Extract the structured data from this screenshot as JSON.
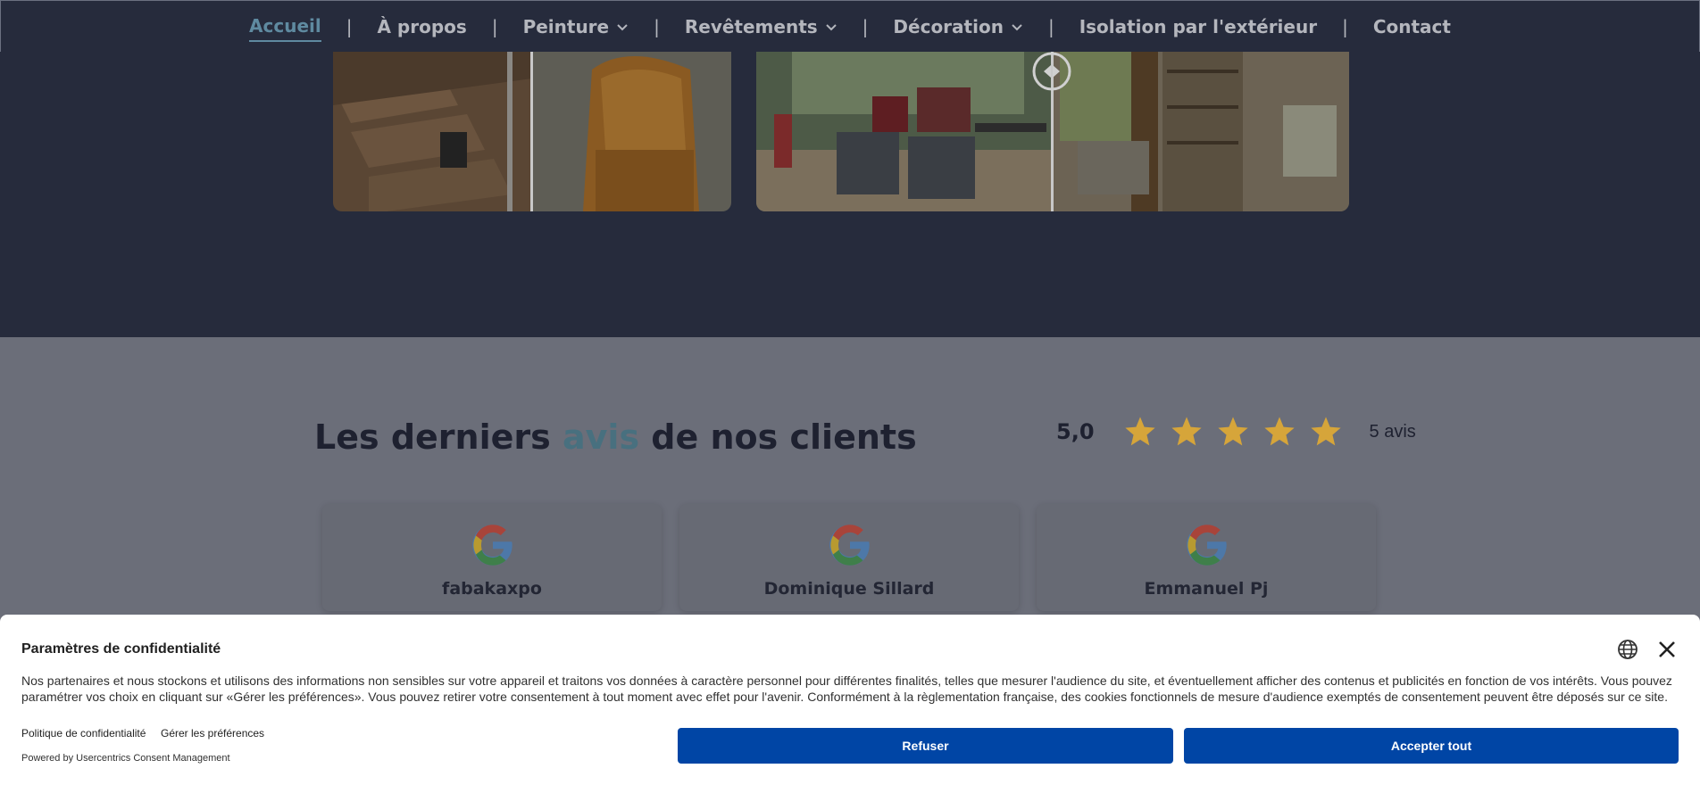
{
  "nav": {
    "items": [
      {
        "label": "Accueil",
        "active": true
      },
      {
        "label": "À propos"
      },
      {
        "label": "Peinture",
        "dropdown": true
      },
      {
        "label": "Revêtements",
        "dropdown": true
      },
      {
        "label": "Décoration",
        "dropdown": true
      },
      {
        "label": "Isolation par l'extérieur"
      },
      {
        "label": "Contact"
      }
    ],
    "separator": "|"
  },
  "reviews": {
    "title_part1": "Les derniers ",
    "title_accent": "avis",
    "title_part2": " de nos clients",
    "rating_value": "5,0",
    "stars": 5,
    "count_label": "5 avis",
    "cards": [
      {
        "name": "fabakaxpo"
      },
      {
        "name": "Dominique Sillard"
      },
      {
        "name": "Emmanuel Pj"
      }
    ]
  },
  "consent": {
    "title": "Paramètres de confidentialité",
    "text": "Nos partenaires et nous stockons et utilisons des informations non sensibles sur votre appareil et traitons vos données à caractère personnel pour différentes finalités, telles que mesurer l'audience du site, et éventuellement afficher des contenus et publicités en fonction de vos intérêts. Vous pouvez paramétrer vos choix en cliquant sur «Gérer les préférences». Vous pouvez retirer votre consentement à tout moment avec effet pour l'avenir. Conformément à la règlementation française, des cookies fonctionnels de mesure d'audience exemptés de consentement peuvent être déposés sur ce site.",
    "privacy_link": "Politique de confidentialité",
    "manage_link": "Gérer les préférences",
    "powered": "Powered by Usercentrics Consent Management",
    "refuse_label": "Refuser",
    "accept_label": "Accepter tout"
  },
  "colors": {
    "nav_bg": "#262b3c",
    "accent": "#5f8aa0",
    "button": "#0045a5",
    "star": "#d6a53a"
  }
}
